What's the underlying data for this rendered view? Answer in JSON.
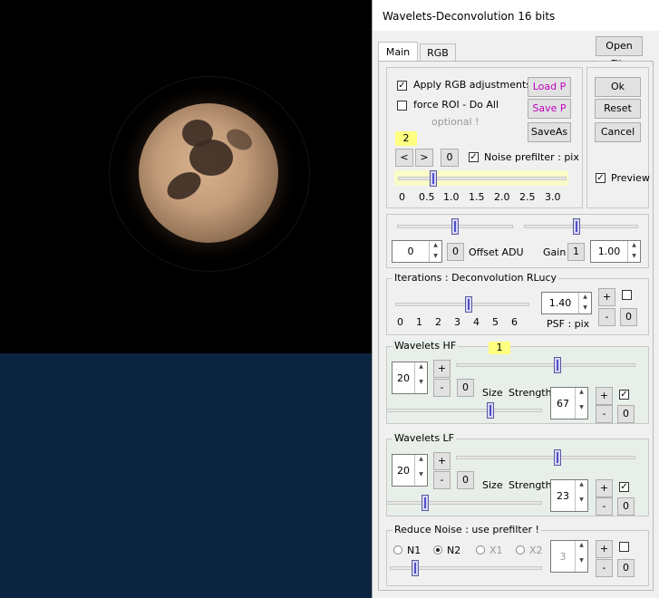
{
  "window": {
    "title": "Wavelets-Deconvolution 16 bits",
    "open_file": "Open File"
  },
  "tabs": [
    {
      "label": "Main"
    },
    {
      "label": "RGB"
    }
  ],
  "top": {
    "apply_rgb": "Apply RGB adjustments",
    "force_roi": "force ROI - Do All",
    "optional": "optional !",
    "load": "Load P",
    "save": "Save P",
    "saveas": "SaveAs",
    "badge": "2",
    "prev": "<",
    "next": ">",
    "zero": "0",
    "noise_prefilter": "Noise prefilter : pix",
    "ticks": [
      "0",
      "0.5",
      "1.0",
      "1.5",
      "2.0",
      "2.5",
      "3.0"
    ]
  },
  "actions": {
    "ok": "Ok",
    "reset": "Reset",
    "cancel": "Cancel",
    "preview": "Preview"
  },
  "offset": {
    "value": "0",
    "zero": "0",
    "label": "Offset ADU",
    "gain_label": "Gain",
    "gain_btn": "1",
    "gain_value": "1.00"
  },
  "iterations": {
    "title": "Iterations : Deconvolution RLucy",
    "ticks": [
      "0",
      "1",
      "2",
      "3",
      "4",
      "5",
      "6"
    ],
    "psf_value": "1.40",
    "psf_label": "PSF : pix",
    "plus": "+",
    "minus": "-",
    "zero": "0"
  },
  "hf": {
    "title": "Wavelets HF",
    "badge": "1",
    "size_value": "20",
    "plus": "+",
    "minus": "-",
    "zero": "0",
    "size_label": "Size",
    "strength_label": "Strength",
    "strength_value": "67",
    "s_plus": "+",
    "s_minus": "-",
    "s_zero": "0"
  },
  "lf": {
    "title": "Wavelets LF",
    "size_value": "20",
    "plus": "+",
    "minus": "-",
    "zero": "0",
    "size_label": "Size",
    "strength_label": "Strength",
    "strength_value": "23",
    "s_plus": "+",
    "s_minus": "-",
    "s_zero": "0"
  },
  "noise": {
    "title": "Reduce Noise : use prefilter !",
    "options": [
      "N1",
      "N2",
      "X1",
      "X2"
    ],
    "selected": "N2",
    "value": "3",
    "plus": "+",
    "minus": "-",
    "zero": "0"
  },
  "colors": {
    "accent_yellow": "#ffff80",
    "button_purple": "#c000c0",
    "image_bottom": "#0b2440"
  }
}
